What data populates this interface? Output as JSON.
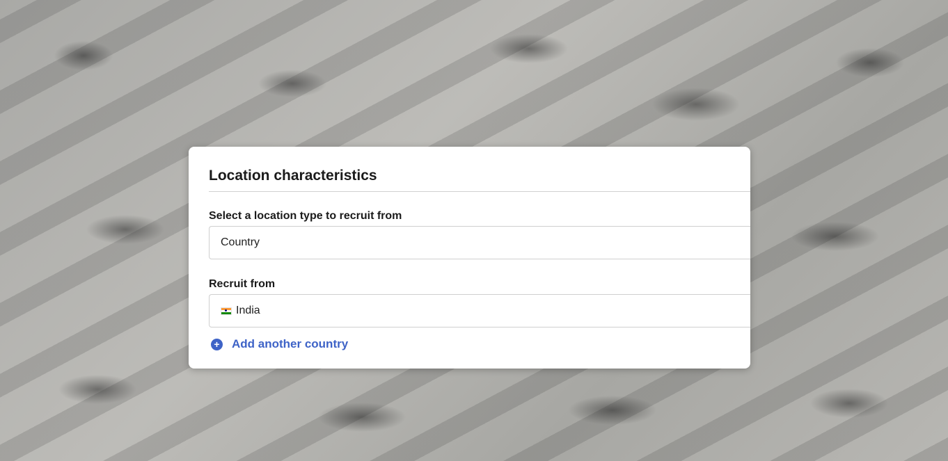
{
  "card": {
    "title": "Location characteristics",
    "location_type": {
      "label": "Select a location type to recruit from",
      "value": "Country"
    },
    "recruit_from": {
      "label": "Recruit from",
      "value": "India",
      "flag_icon": "india-flag-icon"
    },
    "add_country": {
      "label": "Add another country",
      "icon": "plus-circle-icon",
      "color": "#3e63c7"
    }
  }
}
